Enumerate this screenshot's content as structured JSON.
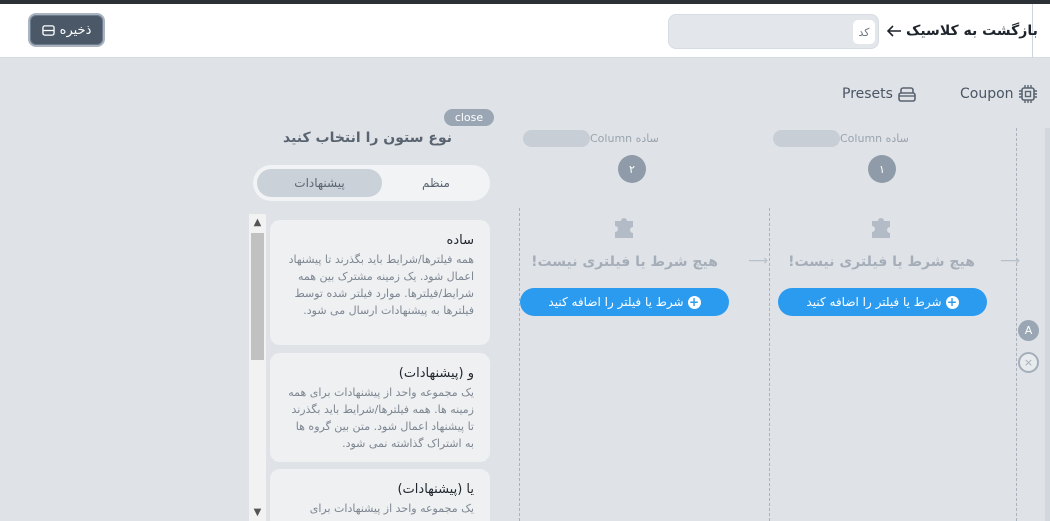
{
  "header": {
    "save_label": "ذخیره",
    "back_label": "بازگشت به کلاسیک",
    "code_tag": "کد"
  },
  "tabs": {
    "coupon": "Coupon",
    "presets": "Presets"
  },
  "columns": [
    {
      "number": "۱",
      "type_label": "ساده",
      "name_label": "Column",
      "empty_text": "هیچ شرط یا فیلتری نیست!",
      "add_label": "شرط یا فیلتر را اضافه کنید"
    },
    {
      "number": "۲",
      "type_label": "ساده",
      "name_label": "Column",
      "empty_text": "هیچ شرط یا فیلتری نیست!",
      "add_label": "شرط یا فیلتر را اضافه کنید"
    }
  ],
  "panel": {
    "close_label": "close",
    "title": "نوع ستون را انتخاب کنید",
    "segments": {
      "regular": "منظم",
      "suggestions": "پیشنهادات",
      "active": "suggestions"
    },
    "cards": [
      {
        "title": "ساده",
        "description": "همه فیلترها/شرایط باید بگذرند تا پیشنهاد اعمال شود. یک زمینه مشترک بین همه شرایط/فیلترها. موارد فیلتر شده توسط فیلترها به پیشنهادات ارسال می شود."
      },
      {
        "title": "و (پیشنهادات)",
        "description": "یک مجموعه واحد از پیشنهادات برای همه زمینه ها. همه فیلترها/شرایط باید بگذرند تا پیشنهاد اعمال شود. متن بین گروه ها به اشتراک گذاشته نمی شود."
      },
      {
        "title": "یا (پیشنهادات)",
        "description": "یک مجموعه واحد از پیشنهادات برای"
      }
    ]
  },
  "side": {
    "badge": "A",
    "remove": "×"
  }
}
